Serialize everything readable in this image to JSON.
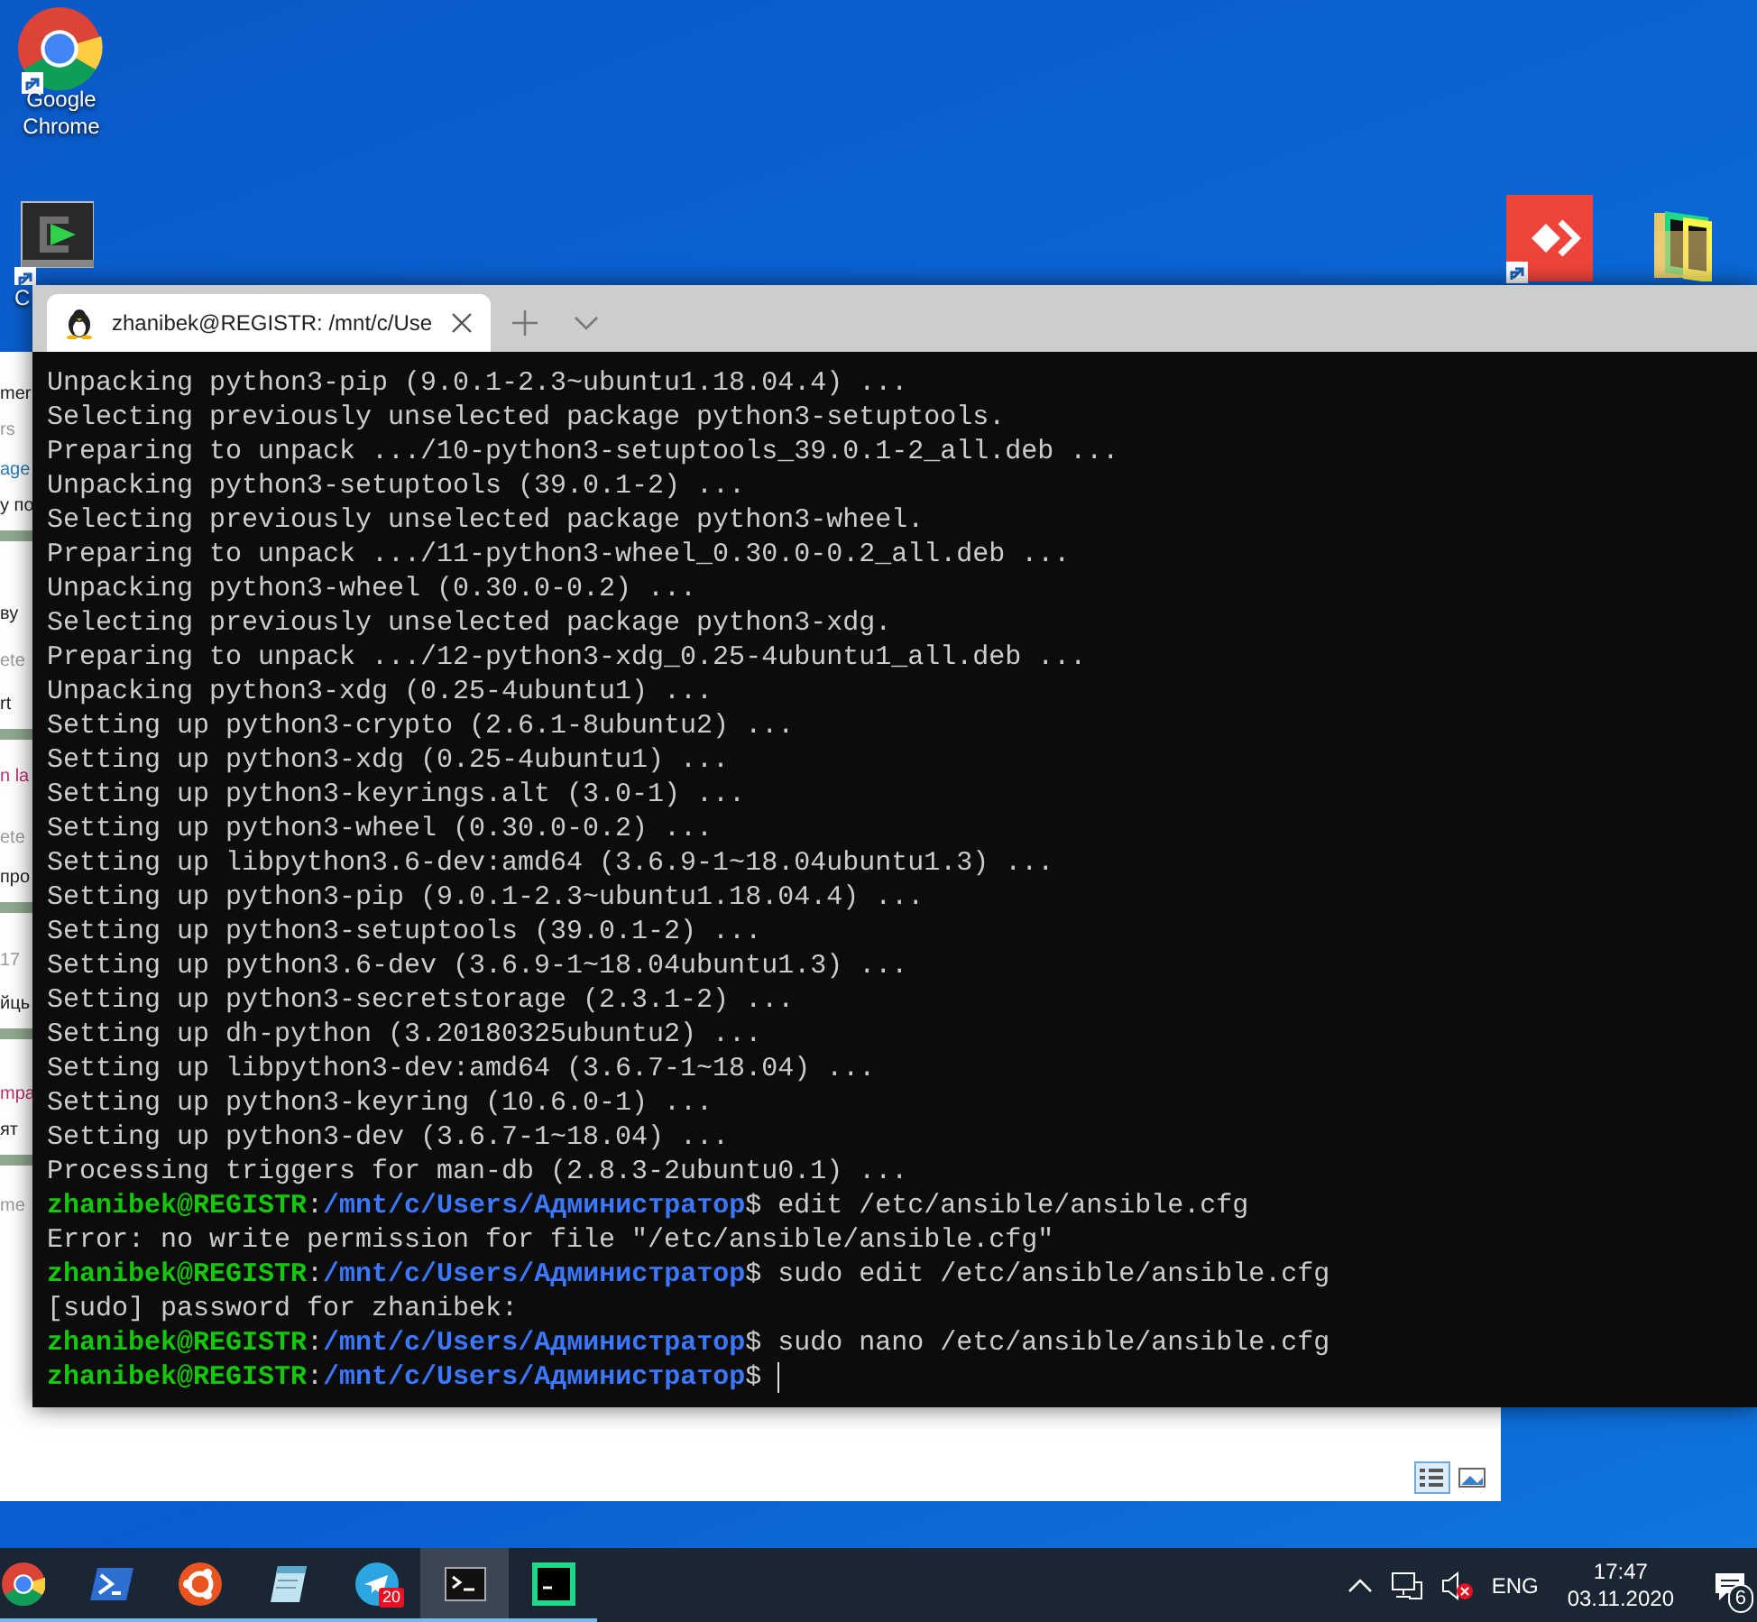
{
  "desktop_icons": [
    {
      "kind": "chrome",
      "label": "Google Chrome"
    },
    {
      "kind": "cygwin",
      "label": "C"
    },
    {
      "kind": "anydesk"
    },
    {
      "kind": "pycharm-folder"
    }
  ],
  "background_window": {
    "fragments": [
      {
        "kind": "text",
        "text": "mer"
      },
      {
        "kind": "muted",
        "text": "rs"
      },
      {
        "kind": "link",
        "text": "age"
      },
      {
        "kind": "text",
        "text": "у по"
      },
      {
        "kind": "bar"
      },
      {
        "kind": "text",
        "text": "ву"
      },
      {
        "kind": "muted",
        "text": "ete"
      },
      {
        "kind": "text",
        "text": "rt"
      },
      {
        "kind": "bar"
      },
      {
        "kind": "accent",
        "text": "n la"
      },
      {
        "kind": "muted",
        "text": "ete"
      },
      {
        "kind": "text",
        "text": "про"
      },
      {
        "kind": "bar"
      },
      {
        "kind": "muted",
        "text": "17"
      },
      {
        "kind": "text",
        "text": "йць"
      },
      {
        "kind": "bar"
      },
      {
        "kind": "accent",
        "text": "mpa"
      },
      {
        "kind": "text",
        "text": "ят"
      },
      {
        "kind": "bar"
      },
      {
        "kind": "muted",
        "text": "me"
      }
    ],
    "view_buttons": [
      {
        "kind": "details",
        "selected": true
      },
      {
        "kind": "preview",
        "selected": false
      }
    ]
  },
  "terminal": {
    "tab_title": "zhanibek@REGISTR: /mnt/c/Use",
    "lines": [
      {
        "kind": "output",
        "text": "Unpacking python3-pip (9.0.1-2.3~ubuntu1.18.04.4) ..."
      },
      {
        "kind": "output",
        "text": "Selecting previously unselected package python3-setuptools."
      },
      {
        "kind": "output",
        "text": "Preparing to unpack .../10-python3-setuptools_39.0.1-2_all.deb ..."
      },
      {
        "kind": "output",
        "text": "Unpacking python3-setuptools (39.0.1-2) ..."
      },
      {
        "kind": "output",
        "text": "Selecting previously unselected package python3-wheel."
      },
      {
        "kind": "output",
        "text": "Preparing to unpack .../11-python3-wheel_0.30.0-0.2_all.deb ..."
      },
      {
        "kind": "output",
        "text": "Unpacking python3-wheel (0.30.0-0.2) ..."
      },
      {
        "kind": "output",
        "text": "Selecting previously unselected package python3-xdg."
      },
      {
        "kind": "output",
        "text": "Preparing to unpack .../12-python3-xdg_0.25-4ubuntu1_all.deb ..."
      },
      {
        "kind": "output",
        "text": "Unpacking python3-xdg (0.25-4ubuntu1) ..."
      },
      {
        "kind": "output",
        "text": "Setting up python3-crypto (2.6.1-8ubuntu2) ..."
      },
      {
        "kind": "output",
        "text": "Setting up python3-xdg (0.25-4ubuntu1) ..."
      },
      {
        "kind": "output",
        "text": "Setting up python3-keyrings.alt (3.0-1) ..."
      },
      {
        "kind": "output",
        "text": "Setting up python3-wheel (0.30.0-0.2) ..."
      },
      {
        "kind": "output",
        "text": "Setting up libpython3.6-dev:amd64 (3.6.9-1~18.04ubuntu1.3) ..."
      },
      {
        "kind": "output",
        "text": "Setting up python3-pip (9.0.1-2.3~ubuntu1.18.04.4) ..."
      },
      {
        "kind": "output",
        "text": "Setting up python3-setuptools (39.0.1-2) ..."
      },
      {
        "kind": "output",
        "text": "Setting up python3.6-dev (3.6.9-1~18.04ubuntu1.3) ..."
      },
      {
        "kind": "output",
        "text": "Setting up python3-secretstorage (2.3.1-2) ..."
      },
      {
        "kind": "output",
        "text": "Setting up dh-python (3.20180325ubuntu2) ..."
      },
      {
        "kind": "output",
        "text": "Setting up libpython3-dev:amd64 (3.6.7-1~18.04) ..."
      },
      {
        "kind": "output",
        "text": "Setting up python3-keyring (10.6.0-1) ..."
      },
      {
        "kind": "output",
        "text": "Setting up python3-dev (3.6.7-1~18.04) ..."
      },
      {
        "kind": "output",
        "text": "Processing triggers for man-db (2.8.3-2ubuntu0.1) ..."
      },
      {
        "kind": "prompt",
        "user": "zhanibek@REGISTR",
        "separator": ":",
        "path": "/mnt/c/Users/Администратор",
        "symbol": "$",
        "command": "edit /etc/ansible/ansible.cfg"
      },
      {
        "kind": "output",
        "text": "Error: no write permission for file \"/etc/ansible/ansible.cfg\""
      },
      {
        "kind": "prompt",
        "user": "zhanibek@REGISTR",
        "separator": ":",
        "path": "/mnt/c/Users/Администратор",
        "symbol": "$",
        "command": "sudo edit /etc/ansible/ansible.cfg"
      },
      {
        "kind": "output",
        "text": "[sudo] password for zhanibek:"
      },
      {
        "kind": "prompt",
        "user": "zhanibek@REGISTR",
        "separator": ":",
        "path": "/mnt/c/Users/Администратор",
        "symbol": "$",
        "command": "sudo nano /etc/ansible/ansible.cfg"
      },
      {
        "kind": "prompt",
        "user": "zhanibek@REGISTR",
        "separator": ":",
        "path": "/mnt/c/Users/Администратор",
        "symbol": "$",
        "cursor": true
      }
    ]
  },
  "taskbar": {
    "apps": [
      {
        "kind": "chrome",
        "selected": false
      },
      {
        "kind": "powershell",
        "selected": false
      },
      {
        "kind": "ubuntu",
        "selected": false
      },
      {
        "kind": "notepad",
        "selected": false
      },
      {
        "kind": "telegram",
        "selected": false,
        "badge": "20"
      },
      {
        "kind": "terminal",
        "selected": true
      },
      {
        "kind": "pycharm",
        "selected": false
      }
    ],
    "tray": {
      "language": "ENG",
      "time": "17:47",
      "date": "03.11.2020",
      "notifications": "6"
    }
  }
}
